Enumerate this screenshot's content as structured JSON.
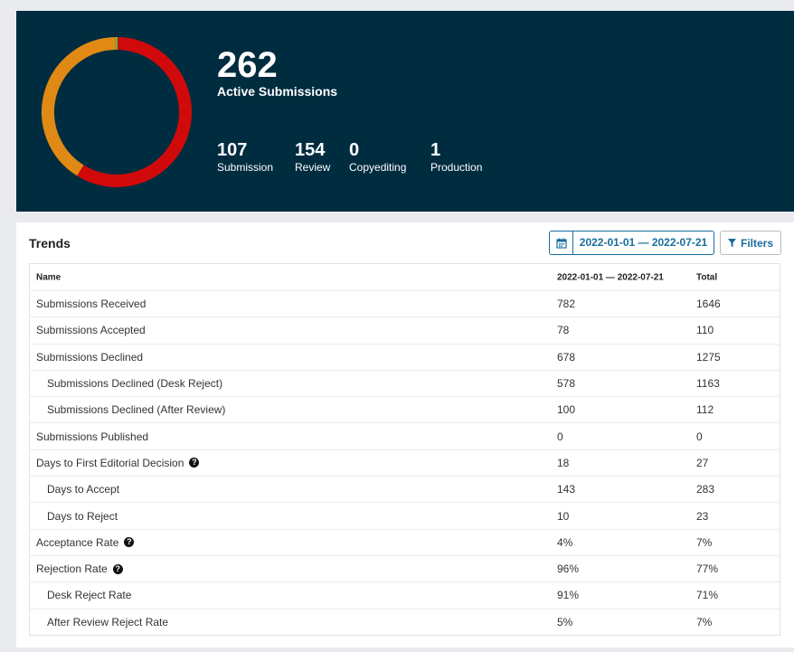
{
  "summary": {
    "total": "262",
    "total_label": "Active Submissions",
    "stages": [
      {
        "value": "107",
        "label": "Submission",
        "color": "#e08914"
      },
      {
        "value": "154",
        "label": "Review",
        "color": "#d00a0a"
      },
      {
        "value": "0",
        "label": "Copyediting",
        "color": "#00b28d"
      },
      {
        "value": "1",
        "label": "Production",
        "color": "#6db33f"
      }
    ]
  },
  "trends": {
    "title": "Trends",
    "date_range": "2022-01-01 — 2022-07-21",
    "filters_label": "Filters",
    "columns": [
      "Name",
      "2022-01-01 — 2022-07-21",
      "Total"
    ],
    "rows": [
      {
        "name": "Submissions Received",
        "range": "782",
        "total": "1646",
        "sub": false,
        "help": false
      },
      {
        "name": "Submissions Accepted",
        "range": "78",
        "total": "110",
        "sub": false,
        "help": false
      },
      {
        "name": "Submissions Declined",
        "range": "678",
        "total": "1275",
        "sub": false,
        "help": false
      },
      {
        "name": "Submissions Declined (Desk Reject)",
        "range": "578",
        "total": "1163",
        "sub": true,
        "help": false
      },
      {
        "name": "Submissions Declined (After Review)",
        "range": "100",
        "total": "112",
        "sub": true,
        "help": false
      },
      {
        "name": "Submissions Published",
        "range": "0",
        "total": "0",
        "sub": false,
        "help": false
      },
      {
        "name": "Days to First Editorial Decision",
        "range": "18",
        "total": "27",
        "sub": false,
        "help": true
      },
      {
        "name": "Days to Accept",
        "range": "143",
        "total": "283",
        "sub": true,
        "help": false
      },
      {
        "name": "Days to Reject",
        "range": "10",
        "total": "23",
        "sub": true,
        "help": false
      },
      {
        "name": "Acceptance Rate",
        "range": "4%",
        "total": "7%",
        "sub": false,
        "help": true
      },
      {
        "name": "Rejection Rate",
        "range": "96%",
        "total": "77%",
        "sub": false,
        "help": true
      },
      {
        "name": "Desk Reject Rate",
        "range": "91%",
        "total": "71%",
        "sub": true,
        "help": false
      },
      {
        "name": "After Review Reject Rate",
        "range": "5%",
        "total": "7%",
        "sub": true,
        "help": false
      }
    ]
  },
  "icons": {
    "calendar": "calendar-icon",
    "filter": "filter-icon",
    "help": "help-icon"
  }
}
